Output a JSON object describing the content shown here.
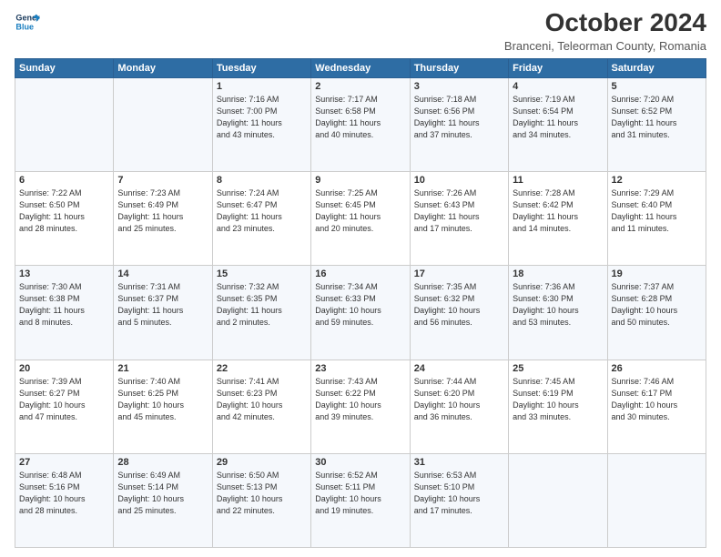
{
  "logo": {
    "line1": "General",
    "line2": "Blue"
  },
  "header": {
    "month": "October 2024",
    "location": "Branceni, Teleorman County, Romania"
  },
  "weekdays": [
    "Sunday",
    "Monday",
    "Tuesday",
    "Wednesday",
    "Thursday",
    "Friday",
    "Saturday"
  ],
  "weeks": [
    [
      {
        "day": "",
        "detail": ""
      },
      {
        "day": "",
        "detail": ""
      },
      {
        "day": "1",
        "detail": "Sunrise: 7:16 AM\nSunset: 7:00 PM\nDaylight: 11 hours\nand 43 minutes."
      },
      {
        "day": "2",
        "detail": "Sunrise: 7:17 AM\nSunset: 6:58 PM\nDaylight: 11 hours\nand 40 minutes."
      },
      {
        "day": "3",
        "detail": "Sunrise: 7:18 AM\nSunset: 6:56 PM\nDaylight: 11 hours\nand 37 minutes."
      },
      {
        "day": "4",
        "detail": "Sunrise: 7:19 AM\nSunset: 6:54 PM\nDaylight: 11 hours\nand 34 minutes."
      },
      {
        "day": "5",
        "detail": "Sunrise: 7:20 AM\nSunset: 6:52 PM\nDaylight: 11 hours\nand 31 minutes."
      }
    ],
    [
      {
        "day": "6",
        "detail": "Sunrise: 7:22 AM\nSunset: 6:50 PM\nDaylight: 11 hours\nand 28 minutes."
      },
      {
        "day": "7",
        "detail": "Sunrise: 7:23 AM\nSunset: 6:49 PM\nDaylight: 11 hours\nand 25 minutes."
      },
      {
        "day": "8",
        "detail": "Sunrise: 7:24 AM\nSunset: 6:47 PM\nDaylight: 11 hours\nand 23 minutes."
      },
      {
        "day": "9",
        "detail": "Sunrise: 7:25 AM\nSunset: 6:45 PM\nDaylight: 11 hours\nand 20 minutes."
      },
      {
        "day": "10",
        "detail": "Sunrise: 7:26 AM\nSunset: 6:43 PM\nDaylight: 11 hours\nand 17 minutes."
      },
      {
        "day": "11",
        "detail": "Sunrise: 7:28 AM\nSunset: 6:42 PM\nDaylight: 11 hours\nand 14 minutes."
      },
      {
        "day": "12",
        "detail": "Sunrise: 7:29 AM\nSunset: 6:40 PM\nDaylight: 11 hours\nand 11 minutes."
      }
    ],
    [
      {
        "day": "13",
        "detail": "Sunrise: 7:30 AM\nSunset: 6:38 PM\nDaylight: 11 hours\nand 8 minutes."
      },
      {
        "day": "14",
        "detail": "Sunrise: 7:31 AM\nSunset: 6:37 PM\nDaylight: 11 hours\nand 5 minutes."
      },
      {
        "day": "15",
        "detail": "Sunrise: 7:32 AM\nSunset: 6:35 PM\nDaylight: 11 hours\nand 2 minutes."
      },
      {
        "day": "16",
        "detail": "Sunrise: 7:34 AM\nSunset: 6:33 PM\nDaylight: 10 hours\nand 59 minutes."
      },
      {
        "day": "17",
        "detail": "Sunrise: 7:35 AM\nSunset: 6:32 PM\nDaylight: 10 hours\nand 56 minutes."
      },
      {
        "day": "18",
        "detail": "Sunrise: 7:36 AM\nSunset: 6:30 PM\nDaylight: 10 hours\nand 53 minutes."
      },
      {
        "day": "19",
        "detail": "Sunrise: 7:37 AM\nSunset: 6:28 PM\nDaylight: 10 hours\nand 50 minutes."
      }
    ],
    [
      {
        "day": "20",
        "detail": "Sunrise: 7:39 AM\nSunset: 6:27 PM\nDaylight: 10 hours\nand 47 minutes."
      },
      {
        "day": "21",
        "detail": "Sunrise: 7:40 AM\nSunset: 6:25 PM\nDaylight: 10 hours\nand 45 minutes."
      },
      {
        "day": "22",
        "detail": "Sunrise: 7:41 AM\nSunset: 6:23 PM\nDaylight: 10 hours\nand 42 minutes."
      },
      {
        "day": "23",
        "detail": "Sunrise: 7:43 AM\nSunset: 6:22 PM\nDaylight: 10 hours\nand 39 minutes."
      },
      {
        "day": "24",
        "detail": "Sunrise: 7:44 AM\nSunset: 6:20 PM\nDaylight: 10 hours\nand 36 minutes."
      },
      {
        "day": "25",
        "detail": "Sunrise: 7:45 AM\nSunset: 6:19 PM\nDaylight: 10 hours\nand 33 minutes."
      },
      {
        "day": "26",
        "detail": "Sunrise: 7:46 AM\nSunset: 6:17 PM\nDaylight: 10 hours\nand 30 minutes."
      }
    ],
    [
      {
        "day": "27",
        "detail": "Sunrise: 6:48 AM\nSunset: 5:16 PM\nDaylight: 10 hours\nand 28 minutes."
      },
      {
        "day": "28",
        "detail": "Sunrise: 6:49 AM\nSunset: 5:14 PM\nDaylight: 10 hours\nand 25 minutes."
      },
      {
        "day": "29",
        "detail": "Sunrise: 6:50 AM\nSunset: 5:13 PM\nDaylight: 10 hours\nand 22 minutes."
      },
      {
        "day": "30",
        "detail": "Sunrise: 6:52 AM\nSunset: 5:11 PM\nDaylight: 10 hours\nand 19 minutes."
      },
      {
        "day": "31",
        "detail": "Sunrise: 6:53 AM\nSunset: 5:10 PM\nDaylight: 10 hours\nand 17 minutes."
      },
      {
        "day": "",
        "detail": ""
      },
      {
        "day": "",
        "detail": ""
      }
    ]
  ]
}
